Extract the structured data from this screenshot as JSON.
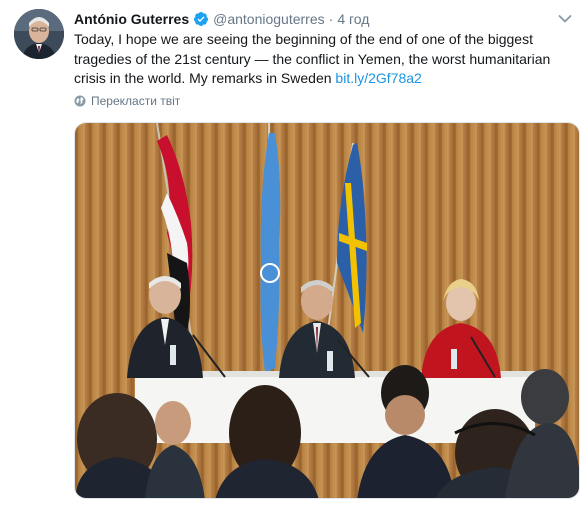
{
  "tweet": {
    "author_name": "António Guterres",
    "handle": "@antonioguterres",
    "separator": "·",
    "time": "4 год",
    "text_before_link": "Today, I hope we are seeing the beginning of the end of one of the biggest tragedies of the 21st century — the conflict in Yemen, the worst humanitarian crisis in the world. My remarks in Sweden ",
    "link_text": "bit.ly/2Gf78a2",
    "translate_label": "Перекласти твіт",
    "verified": true
  },
  "icons": {
    "verified": "verified-badge-icon",
    "menu": "chevron-down-icon",
    "translate": "globe-icon"
  },
  "colors": {
    "link": "#1b95e0",
    "verified": "#1da1f2",
    "muted": "#657786",
    "text": "#14171a"
  }
}
